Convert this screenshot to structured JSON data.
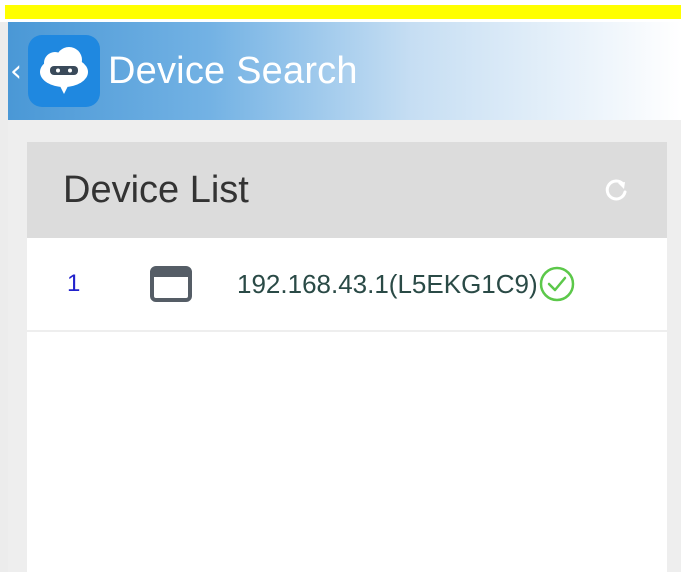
{
  "header": {
    "title": "Device Search",
    "back_icon": "chevron-left-icon",
    "app_icon": "cloud-ninja-icon"
  },
  "panel": {
    "title": "Device List",
    "refresh_icon": "refresh-icon"
  },
  "devices": [
    {
      "index": "1",
      "label": "192.168.43.1(L5EKG1C9)",
      "icon": "device-window-icon",
      "status": "connected-check-icon"
    }
  ],
  "colors": {
    "header_start": "#4a98d6",
    "accent_check": "#5cc84a",
    "index_color": "#2222cc",
    "top_strip": "#ffff00"
  }
}
